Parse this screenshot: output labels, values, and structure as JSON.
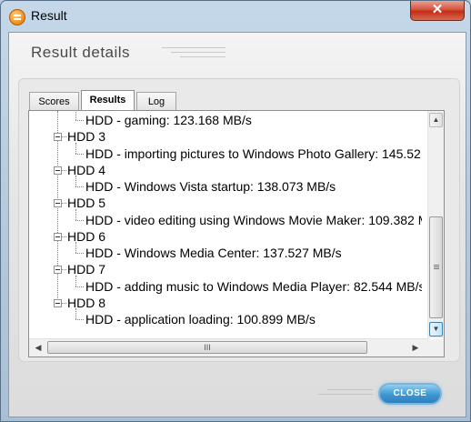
{
  "window": {
    "title": "Result",
    "close_glyph": "✕"
  },
  "header": {
    "title": "Result details"
  },
  "tabs": [
    {
      "label": "Scores"
    },
    {
      "label": "Results"
    },
    {
      "label": "Log"
    }
  ],
  "tree": {
    "rows": [
      {
        "text": "HDD - gaming: 123.168 MB/s"
      },
      {
        "text": "HDD 3"
      },
      {
        "text": "HDD - importing pictures to Windows Photo Gallery: 145.52"
      },
      {
        "text": "HDD 4"
      },
      {
        "text": "HDD - Windows Vista startup: 138.073 MB/s"
      },
      {
        "text": "HDD 5"
      },
      {
        "text": "HDD - video editing using Windows Movie Maker: 109.382 M"
      },
      {
        "text": "HDD 6"
      },
      {
        "text": "HDD - Windows Media Center: 137.527 MB/s"
      },
      {
        "text": "HDD 7"
      },
      {
        "text": "HDD - adding music to Windows Media Player: 82.544 MB/s"
      },
      {
        "text": "HDD 8"
      },
      {
        "text": "HDD - application loading: 100.899 MB/s"
      }
    ]
  },
  "scrollbars": {
    "hthumb_grip": "III"
  },
  "footer": {
    "close_label": "CLOSE"
  },
  "icons": {
    "app": "app-icon",
    "close": "close-icon",
    "expander": "collapse-icon",
    "up": "scroll-up-icon",
    "down": "scroll-down-icon",
    "left": "scroll-left-icon",
    "right": "scroll-right-icon"
  }
}
